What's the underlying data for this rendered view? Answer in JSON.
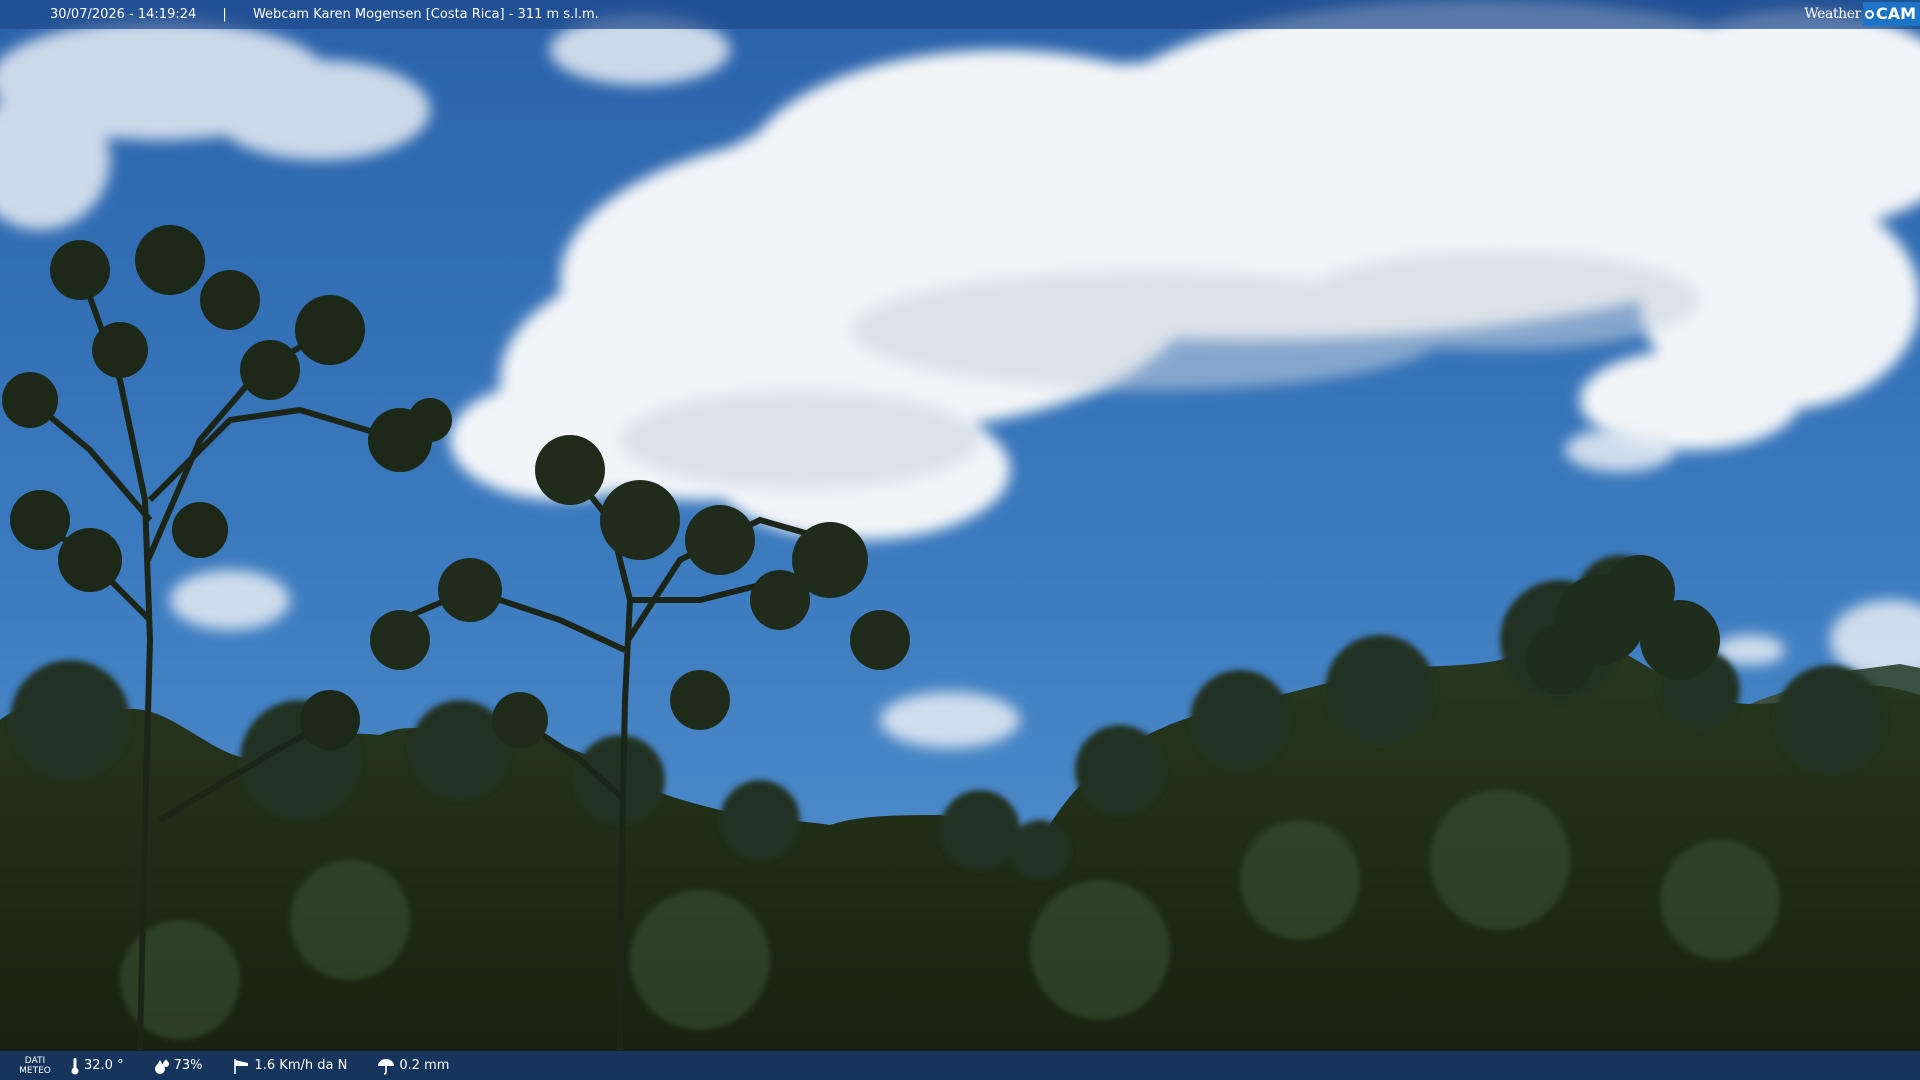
{
  "header": {
    "datetime": "30/07/2026 - 14:19:24",
    "separator": "|",
    "title": "Webcam Karen Mogensen [Costa Rica]  - 311 m s.l.m."
  },
  "brand": {
    "weather": "Weather",
    "cam": "CAM"
  },
  "meteo": {
    "label_line1": "DATI",
    "label_line2": "METEO",
    "temperature": "32.0 °",
    "humidity": "73%",
    "wind": "1.6 Km/h da N",
    "rain": "0.2 mm"
  },
  "icons": {
    "temperature": "thermometer-icon",
    "humidity": "humidity-drop-icon",
    "wind": "wind-sock-icon",
    "rain": "rain-umbrella-icon"
  },
  "colors": {
    "sky_top": "#2a62aa",
    "sky_bottom": "#4f8fcf",
    "cloud": "#f4f6f8",
    "foliage": "#1d2a1a",
    "bar": "#1e498c",
    "brand_blue": "#1c74c6"
  }
}
